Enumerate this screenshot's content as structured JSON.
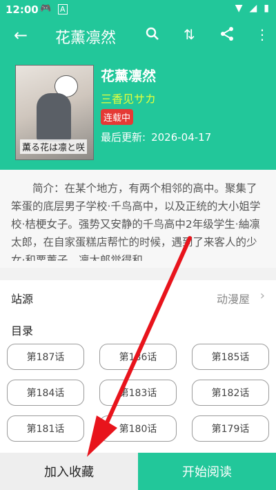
{
  "status_bar": {
    "time": "12:00",
    "game_icon": "gamepad-icon",
    "a_icon": "A"
  },
  "app_bar": {
    "title": "花薰凛然",
    "icons": [
      "back-arrow-icon",
      "search-icon",
      "sort-icon",
      "share-icon",
      "more-icon"
    ]
  },
  "manga": {
    "title": "花薰凛然",
    "author": "三香见サカ",
    "status": "连载中",
    "updated_label": "最后更新:",
    "updated_date": "2026-04-17",
    "cover_title": "薫る花は凛と咲"
  },
  "synopsis": "简介：在某个地方，有两个相邻的高中。聚集了笨蛋的底层男子学校·千鸟高中，以及正统的大小姐学校·桔梗女子。强势又安静的千鸟高中2年级学生·紬凛太郎，在自家蛋糕店帮忙的时候，遇到了来客人的少女·和栗薰子。凛太郎觉得和…",
  "source": {
    "label": "站源",
    "value": "动漫屋"
  },
  "catalog": {
    "heading": "目录",
    "chapters": [
      "第187话",
      "第186话",
      "第185话",
      "第184话",
      "第183话",
      "第182话",
      "第181话",
      "第180话",
      "第179话"
    ]
  },
  "bottom": {
    "favorite": "加入收藏",
    "read": "开始阅读"
  },
  "colors": {
    "accent": "#22c79a",
    "author": "#e6ff3c",
    "badge": "#e53935",
    "arrow": "#e8141c"
  }
}
